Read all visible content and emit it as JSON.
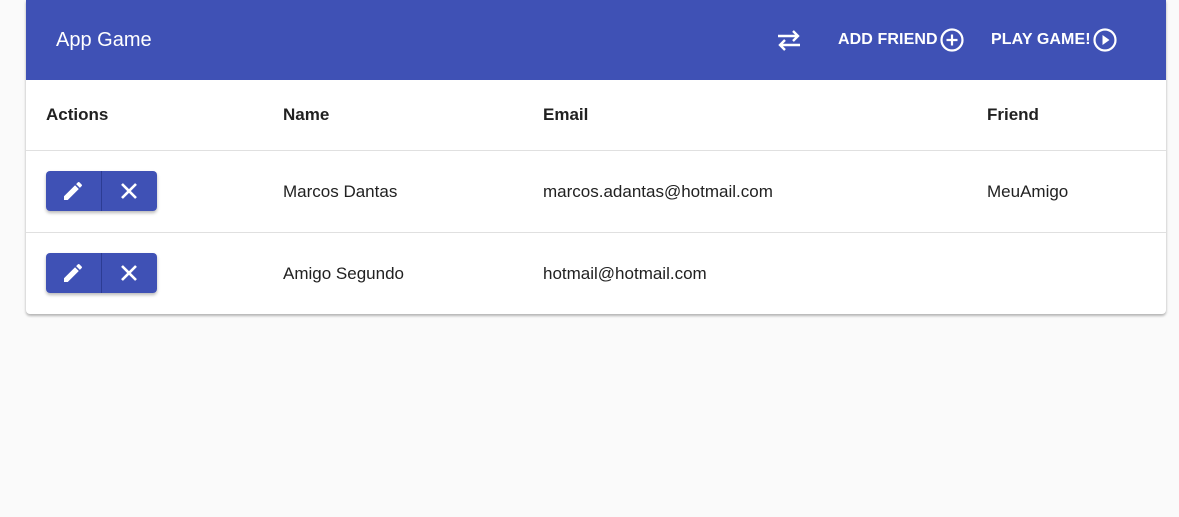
{
  "app": {
    "title": "App Game",
    "accent_color": "#3f51b5"
  },
  "toolbar": {
    "swap_icon": "swap-horizontal-icon",
    "add_friend_label": "ADD FRIEND",
    "add_friend_icon": "add-circle-outline-icon",
    "play_game_label": "PLAY GAME!",
    "play_game_icon": "play-circle-outline-icon"
  },
  "table": {
    "columns": [
      "Actions",
      "Name",
      "Email",
      "Friend"
    ],
    "rows": [
      {
        "name": "Marcos Dantas",
        "email": "marcos.adantas@hotmail.com",
        "friend": "MeuAmigo",
        "actions": [
          "edit-icon",
          "close-icon"
        ]
      },
      {
        "name": "Amigo Segundo",
        "email": "hotmail@hotmail.com",
        "friend": "",
        "actions": [
          "edit-icon",
          "close-icon"
        ]
      }
    ]
  }
}
